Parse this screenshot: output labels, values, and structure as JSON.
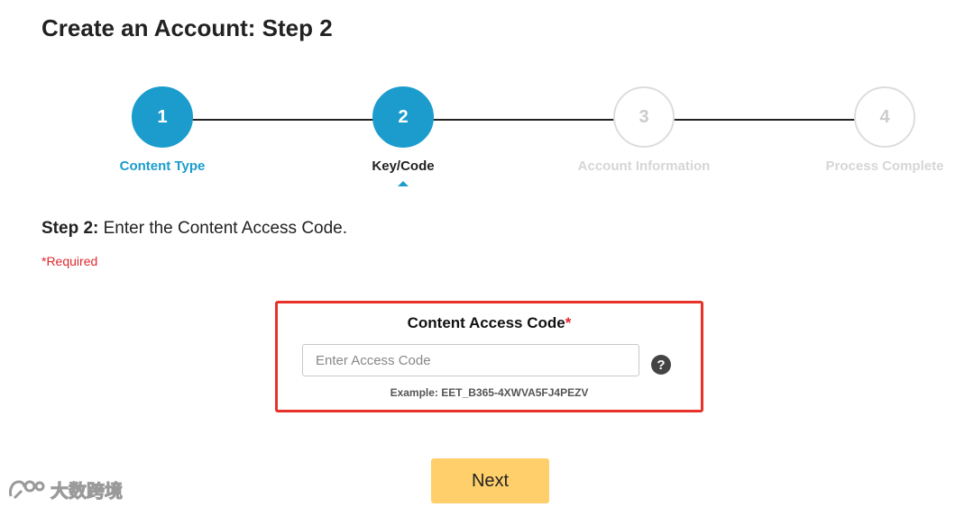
{
  "page": {
    "title": "Create an Account: Step 2"
  },
  "stepper": {
    "steps": [
      {
        "number": "1",
        "label": "Content Type",
        "state": "done"
      },
      {
        "number": "2",
        "label": "Key/Code",
        "state": "active"
      },
      {
        "number": "3",
        "label": "Account Information",
        "state": "pending"
      },
      {
        "number": "4",
        "label": "Process Complete",
        "state": "pending"
      }
    ]
  },
  "instruction": {
    "prefix": "Step 2:",
    "text": " Enter the Content Access Code."
  },
  "required_note": "*Required",
  "access_code": {
    "title": "Content Access Code",
    "required_marker": "*",
    "value": "",
    "placeholder": "Enter Access Code",
    "help_icon": "question-circle-icon",
    "example": "Example: EET_B365-4XWVA5FJ4PEZV"
  },
  "next_button": {
    "label": "Next"
  },
  "watermark": {
    "text": "大数跨境"
  },
  "colors": {
    "accent": "#1b9ccd",
    "required": "#e0282e",
    "highlight_border": "#e8322a",
    "next_button": "#ffcf6b",
    "pending_step": "#dddddd"
  }
}
